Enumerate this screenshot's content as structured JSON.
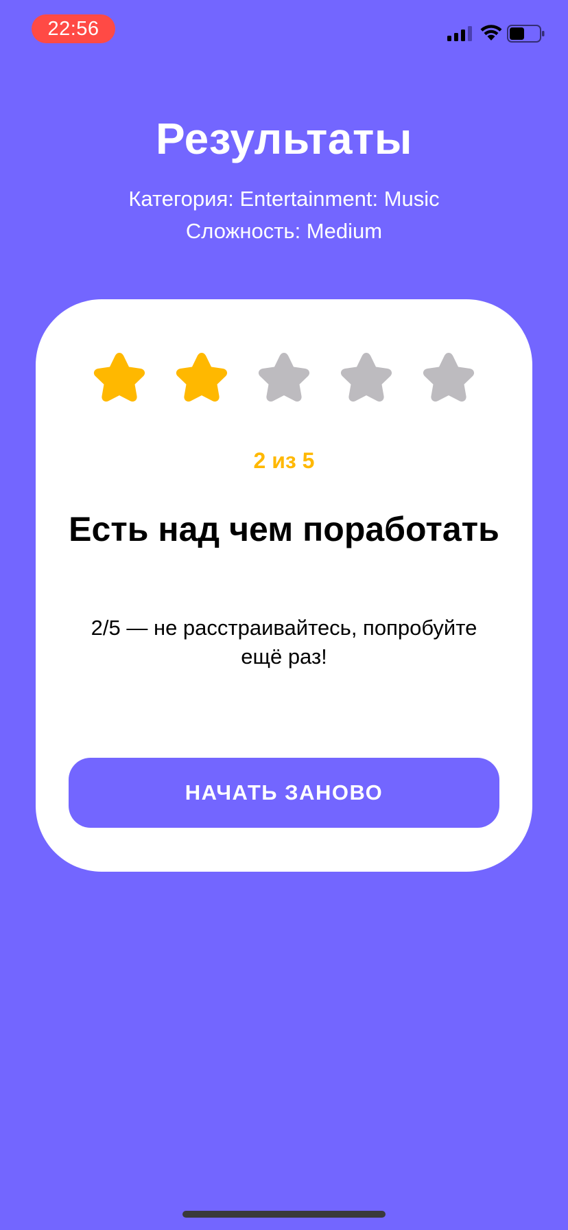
{
  "status_bar": {
    "time": "22:56",
    "signal_icon": "cellular-signal-icon",
    "wifi_icon": "wifi-icon",
    "battery_icon": "battery-icon",
    "battery_level": 0.5
  },
  "header": {
    "title": "Результаты",
    "category": "Категория: Entertainment: Music",
    "difficulty": "Сложность: Medium"
  },
  "result": {
    "rating": 2,
    "max_rating": 5,
    "score_text": "2 из 5",
    "heading": "Есть над чем поработать",
    "message": "2/5 — не расстраивайтесь, попробуйте ещё раз!",
    "star_icon": "star-icon",
    "colors": {
      "star_filled": "#FFB800",
      "star_empty": "#BDBBBF"
    }
  },
  "actions": {
    "restart_label": "НАЧАТЬ ЗАНОВО"
  },
  "colors": {
    "background": "#7366FF",
    "card": "#FFFFFF",
    "accent": "#FFB800",
    "time_pill": "#FF4A45"
  }
}
